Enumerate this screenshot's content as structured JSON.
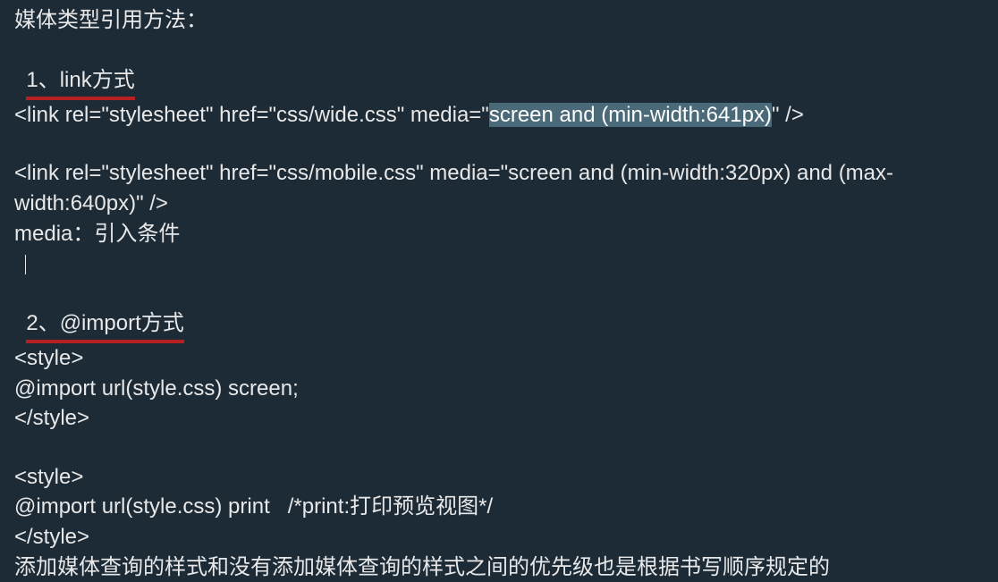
{
  "title": "媒体类型引用方法：",
  "section1": {
    "heading": "1、link方式",
    "link1_prefix": "<link rel=\"stylesheet\" href=\"css/wide.css\" media=\"",
    "link1_selected": "screen and (min-width:641px)",
    "link1_suffix": "\" />",
    "link2": "<link rel=\"stylesheet\" href=\"css/mobile.css\" media=\"screen and (min-width:320px) and (max-width:640px)\" />",
    "media_note": "media：引入条件"
  },
  "section2": {
    "heading": "2、@import方式",
    "style_open1": "<style>",
    "import1": "@import url(style.css) screen;",
    "style_close1": "</style>",
    "style_open2": "<style>",
    "import2": "@import url(style.css) print   /*print:打印预览视图*/",
    "style_close2": "</style>"
  },
  "footer_note": "添加媒体查询的样式和没有添加媒体查询的样式之间的优先级也是根据书写顺序规定的"
}
